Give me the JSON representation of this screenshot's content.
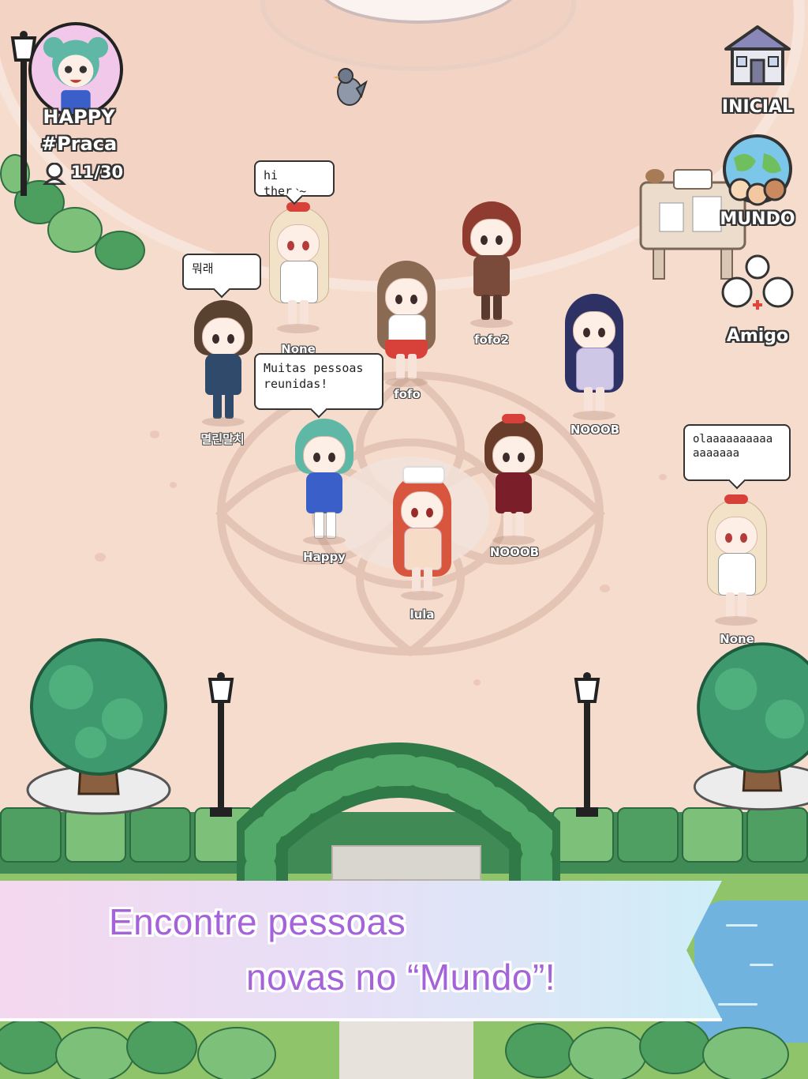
{
  "hud": {
    "player_name": "HAPPY",
    "room_name": "#Praca",
    "occupancy": "11/30"
  },
  "side_menu": {
    "home_label": "INICIAL",
    "world_label": "MUNDO",
    "friend_label": "Amigo"
  },
  "players": [
    {
      "name": "None",
      "bubble": "hi there~"
    },
    {
      "name": "멸린말치",
      "bubble": "뭐래"
    },
    {
      "name": "fofo",
      "bubble": ""
    },
    {
      "name": "fofo2",
      "bubble": ""
    },
    {
      "name": "NOOOB",
      "bubble": ""
    },
    {
      "name": "Happy",
      "bubble": "Muitas pessoas reunidas!"
    },
    {
      "name": "NOOOB",
      "bubble": ""
    },
    {
      "name": "lula",
      "bubble": ""
    },
    {
      "name": "None",
      "bubble": "olaaaaaaaaaa aaaaaaa"
    }
  ],
  "banner": {
    "line1": "Encontre pessoas",
    "line2": "novas no “Mundo”!"
  },
  "colors": {
    "banner_text": "#a563d9",
    "plaza_floor": "#f6dccd",
    "hedge": "#3f8a55"
  }
}
